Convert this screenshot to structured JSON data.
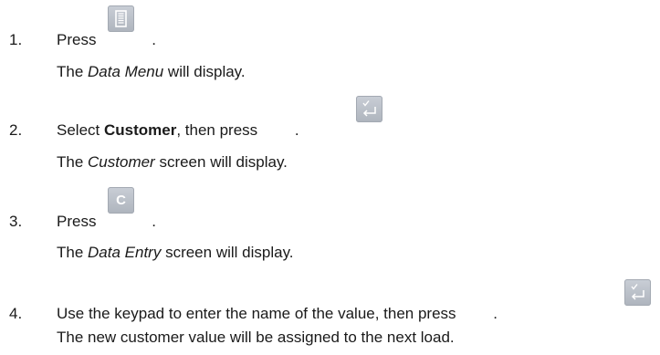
{
  "steps": [
    {
      "number": "1.",
      "pre": "Press ",
      "post": ".",
      "key": "data-menu-key-icon",
      "result_pre": "The ",
      "result_em": "Data Menu",
      "result_post": " will display."
    },
    {
      "number": "2.",
      "pre": "Select ",
      "bold": "Customer",
      "mid": ", then press ",
      "post": ".",
      "key": "enter-key-icon",
      "result_pre": "The ",
      "result_em": "Customer",
      "result_post": " screen will display."
    },
    {
      "number": "3.",
      "pre": "Press ",
      "post": ".",
      "key": "c-key-icon",
      "key_letter": "C",
      "result_pre": "The ",
      "result_em": "Data Entry",
      "result_post": " screen will display."
    },
    {
      "number": "4.",
      "pre": "Use the keypad to enter the name of the value, then press ",
      "post": ".",
      "key": "enter-key-icon",
      "result": "The new customer value will be assigned to the next load."
    }
  ],
  "colors": {
    "text": "#1a1a1a",
    "key_background": "#b9bec6",
    "key_glyph": "#ffffff"
  }
}
